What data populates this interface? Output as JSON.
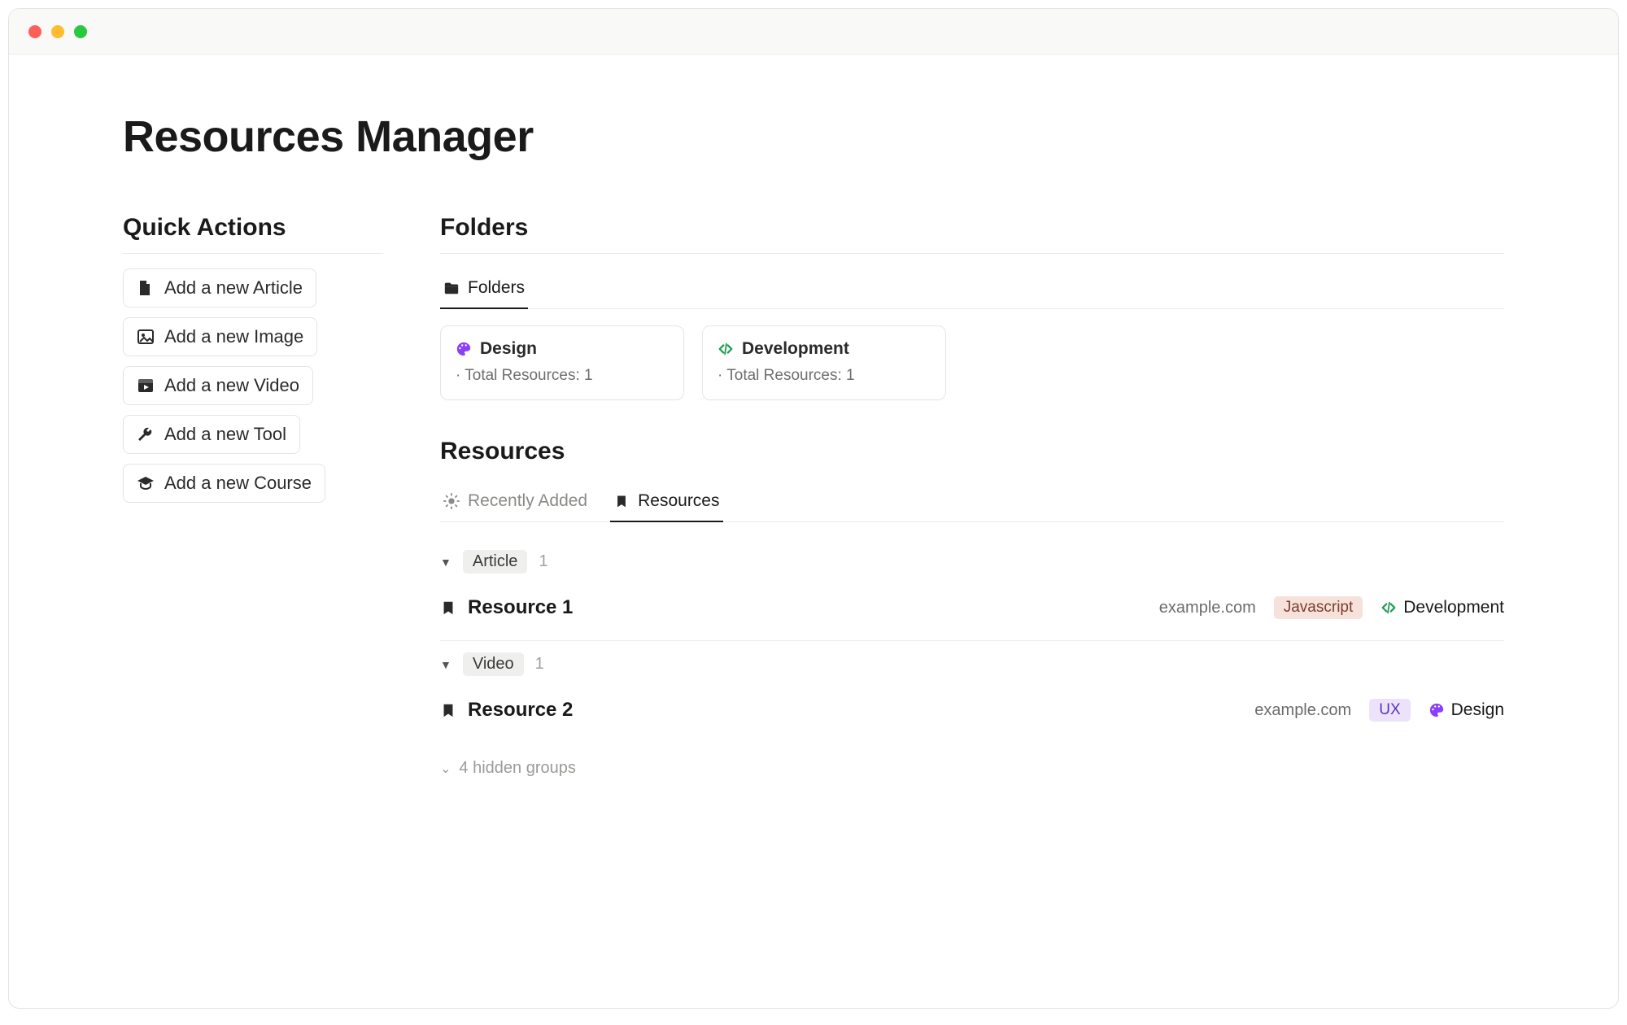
{
  "page": {
    "title": "Resources Manager"
  },
  "quick_actions": {
    "heading": "Quick Actions",
    "items": [
      {
        "label": "Add a new Article",
        "icon": "file-icon"
      },
      {
        "label": "Add a new Image",
        "icon": "image-icon"
      },
      {
        "label": "Add a new Video",
        "icon": "video-icon"
      },
      {
        "label": "Add a new Tool",
        "icon": "wrench-icon"
      },
      {
        "label": "Add a new Course",
        "icon": "graduation-icon"
      }
    ]
  },
  "folders_section": {
    "heading": "Folders",
    "tab_label": "Folders",
    "cards": [
      {
        "name": "Design",
        "meta": "Total Resources: 1",
        "icon": "palette-icon",
        "icon_color": "#8a3ffc"
      },
      {
        "name": "Development",
        "meta": "Total Resources: 1",
        "icon": "code-icon",
        "icon_color": "#1f9d55"
      }
    ]
  },
  "resources_section": {
    "heading": "Resources",
    "tabs": [
      {
        "label": "Recently Added",
        "icon": "sun-icon",
        "active": false
      },
      {
        "label": "Resources",
        "icon": "bookmark-icon",
        "active": true
      }
    ],
    "groups": [
      {
        "name": "Article",
        "count": "1",
        "rows": [
          {
            "title": "Resource 1",
            "domain": "example.com",
            "tag": {
              "label": "Javascript",
              "bg": "#f7e2db",
              "fg": "#7a3d2c"
            },
            "folder": {
              "name": "Development",
              "icon": "code-icon",
              "color": "#1f9d55"
            }
          }
        ]
      },
      {
        "name": "Video",
        "count": "1",
        "rows": [
          {
            "title": "Resource 2",
            "domain": "example.com",
            "tag": {
              "label": "UX",
              "bg": "#ece3fb",
              "fg": "#5b36b5"
            },
            "folder": {
              "name": "Design",
              "icon": "palette-icon",
              "color": "#8a3ffc"
            }
          }
        ]
      }
    ],
    "hidden_groups_label": "4 hidden groups"
  }
}
